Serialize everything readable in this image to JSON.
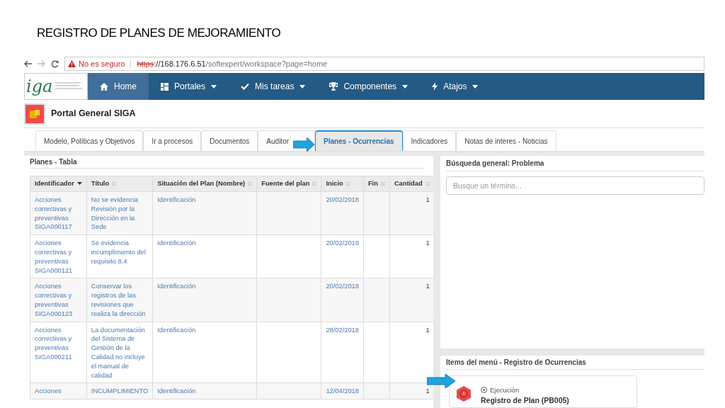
{
  "slide_title": "REGISTRO DE PLANES DE MEJORAMIENTO",
  "browser": {
    "warning": "No es seguro",
    "scheme": "https",
    "host": "://168.176.6.51",
    "path": "/softexpert/workspace?page=home"
  },
  "navbar": {
    "logo": "iga",
    "items": [
      {
        "label": "Home",
        "selected": true,
        "dropdown": false
      },
      {
        "label": "Portales",
        "selected": false,
        "dropdown": true
      },
      {
        "label": "Mis tareas",
        "selected": false,
        "dropdown": true
      },
      {
        "label": "Componentes",
        "selected": false,
        "dropdown": true
      },
      {
        "label": "Atajos",
        "selected": false,
        "dropdown": true
      }
    ]
  },
  "portal_title": "Portal General SIGA",
  "tabs": [
    {
      "label": "Modelo, Políticas y Objetivos",
      "selected": false
    },
    {
      "label": "Ir a procesos",
      "selected": false
    },
    {
      "label": "Documentos",
      "selected": false
    },
    {
      "label": "Auditor",
      "selected": false
    },
    {
      "label": "Planes - Ocurrencias",
      "selected": true
    },
    {
      "label": "Indicadores",
      "selected": false
    },
    {
      "label": "Notas de interes - Noticias",
      "selected": false
    }
  ],
  "table_panel": {
    "title": "Planes - Tabla",
    "columns": [
      {
        "label": "Identificador",
        "sorted": true
      },
      {
        "label": "Título",
        "sorted": false
      },
      {
        "label": "Situación del Plan (Nombre)",
        "sorted": false
      },
      {
        "label": "Fuente del plan",
        "sorted": false
      },
      {
        "label": "Inicio",
        "sorted": false
      },
      {
        "label": "Fin",
        "sorted": false
      },
      {
        "label": "Cantidad",
        "sorted": false
      }
    ],
    "rows": [
      {
        "id": "Acciones correctivas y preventivas SIGA000117",
        "title": "No se evidencia Revisión por la Dirección en la Sede",
        "status": "Identificación",
        "start": "20/02/2018",
        "count": "1"
      },
      {
        "id": "Acciones correctivas y preventivas SIGA000121",
        "title": "Se evidencia incumplimiento del requisito 8.4",
        "status": "Identificación",
        "start": "20/02/2018",
        "count": "1"
      },
      {
        "id": "Acciones correctivas y preventivas SIGA000123",
        "title": "Conservar los registros de las revisiones que realiza la dirección",
        "status": "Identificación",
        "start": "20/02/2018",
        "count": "1"
      },
      {
        "id": "Acciones correctivas y preventivas SIGA000211",
        "title": "La documentación del Sistema de Gestión de la Calidad no incluye el manual de calidad",
        "status": "Identificación",
        "start": "28/02/2018",
        "count": "1"
      },
      {
        "id": "Acciones",
        "title": "INCUMPLIMIENTO",
        "status": "Identificación",
        "start": "12/04/2018",
        "count": "1"
      }
    ]
  },
  "search_panel": {
    "title": "Búsqueda general: Problema",
    "placeholder": "Busque un término..."
  },
  "menu_panel": {
    "title": "Items del menú - Registro de Ocurrencias",
    "item": {
      "category": "Ejecución",
      "title": "Registro de Plan (PB005)"
    }
  }
}
